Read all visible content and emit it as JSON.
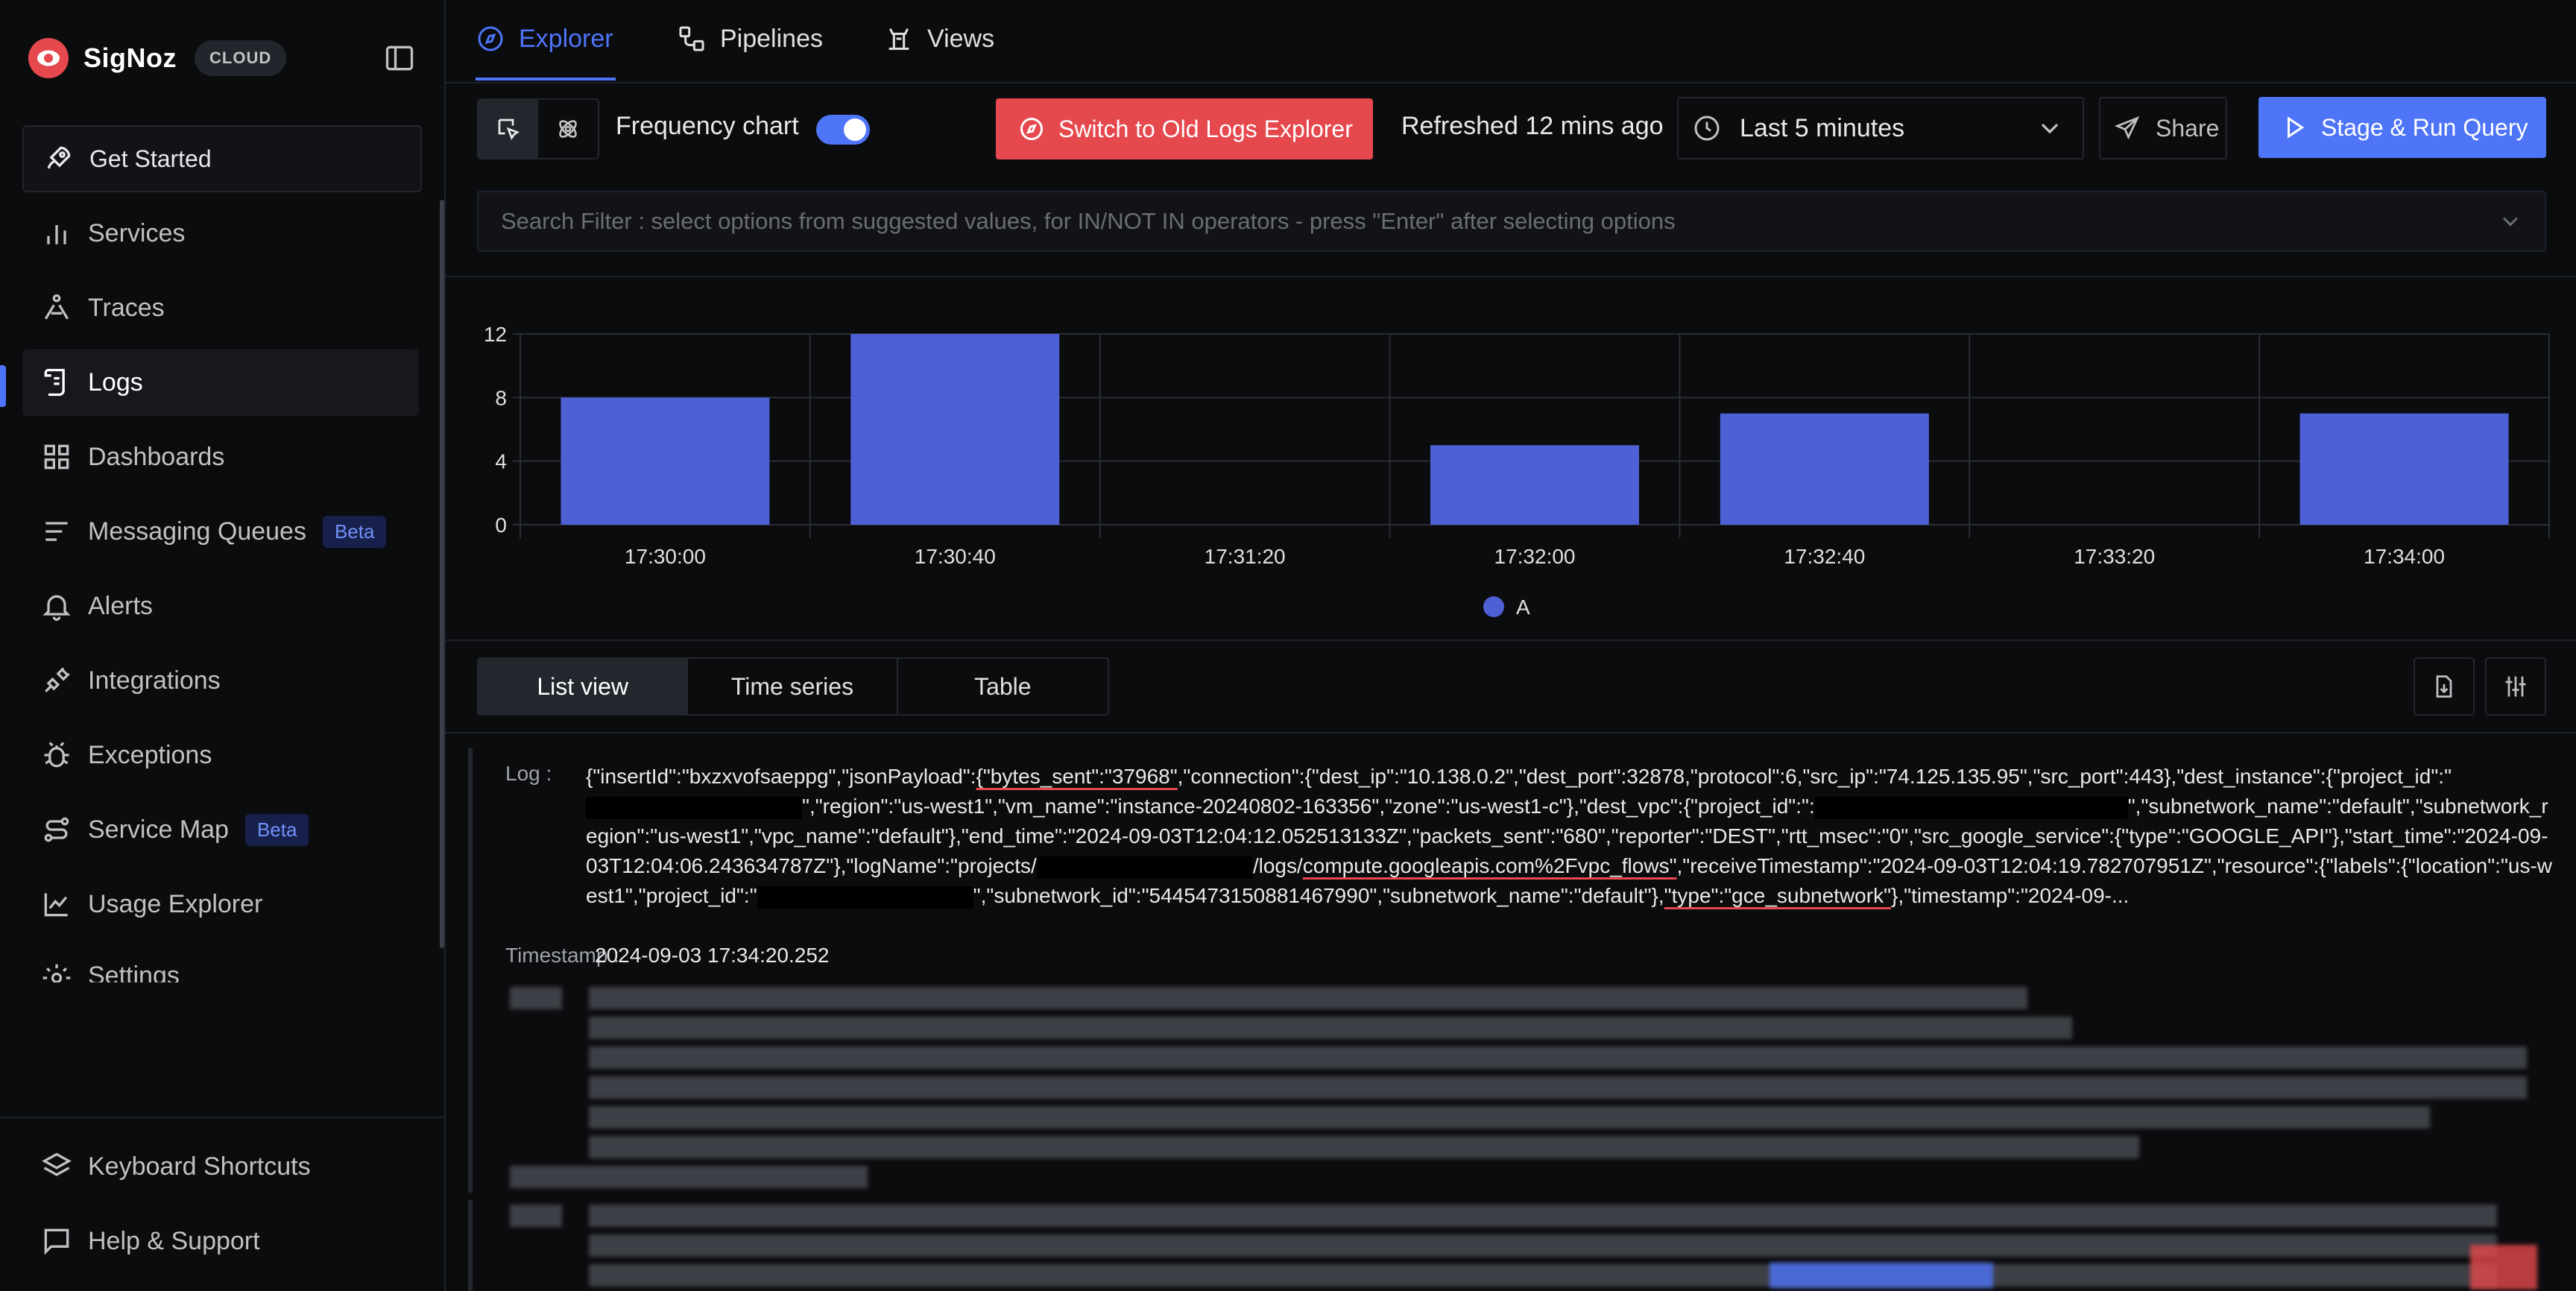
{
  "sidebar": {
    "brand": "SigNoz",
    "badge": "CLOUD",
    "get_started": "Get Started",
    "items": [
      {
        "label": "Services",
        "icon": "bar-chart-icon"
      },
      {
        "label": "Traces",
        "icon": "draw-path-icon"
      },
      {
        "label": "Logs",
        "icon": "scroll-text-icon",
        "active": true
      },
      {
        "label": "Dashboards",
        "icon": "grid-icon"
      },
      {
        "label": "Messaging Queues",
        "icon": "list-icon",
        "badge": "Beta"
      },
      {
        "label": "Alerts",
        "icon": "bell-icon"
      },
      {
        "label": "Integrations",
        "icon": "plug-icon"
      },
      {
        "label": "Exceptions",
        "icon": "bug-icon"
      },
      {
        "label": "Service Map",
        "icon": "route-icon",
        "badge": "Beta"
      },
      {
        "label": "Usage Explorer",
        "icon": "line-chart-icon"
      },
      {
        "label": "Settings",
        "icon": "gear-icon"
      }
    ],
    "bottom": [
      {
        "label": "Keyboard Shortcuts",
        "icon": "layers-icon"
      },
      {
        "label": "Help & Support",
        "icon": "message-square-icon"
      }
    ]
  },
  "tabs": [
    {
      "label": "Explorer",
      "icon": "compass-icon",
      "active": true
    },
    {
      "label": "Pipelines",
      "icon": "workflow-icon"
    },
    {
      "label": "Views",
      "icon": "tower-icon"
    }
  ],
  "toolbar": {
    "frequency_label": "Frequency chart",
    "frequency_on": true,
    "old_explorer": "Switch to Old Logs Explorer",
    "refreshed": "Refreshed 12 mins ago",
    "time_range": "Last 5 minutes",
    "share": "Share",
    "run": "Stage & Run Query"
  },
  "search": {
    "placeholder": "Search Filter : select options from suggested values, for IN/NOT IN operators - press \"Enter\" after selecting options"
  },
  "chart_data": {
    "type": "bar",
    "categories": [
      "17:30:00",
      "17:30:40",
      "17:31:20",
      "17:32:00",
      "17:32:40",
      "17:33:20",
      "17:34:00"
    ],
    "series": [
      {
        "name": "A",
        "color": "#4e60d6",
        "values": [
          8,
          12,
          0,
          5,
          7,
          0,
          7
        ]
      }
    ],
    "yticks": [
      0,
      4,
      8,
      12
    ],
    "ylim": [
      0,
      12
    ],
    "legend": "bottom-center",
    "grid": true
  },
  "view_tabs": [
    "List view",
    "Time series",
    "Table"
  ],
  "log": {
    "label": "Log :",
    "timestamp_label": "Timestamp :",
    "timestamp": "2024-09-03 17:34:20.252",
    "line1_a": "{\"insertId\":\"bxzxvofsaeppg\",\"jsonPayload\":",
    "line1_u": "{\"bytes_sent\":\"37968\"",
    "line1_b": ",\"connection\":{\"dest_ip\":\"10.138.0.2\",\"dest_port\":32878,\"protocol\":6,\"src_ip\":\"74.125.135.95\",\"src_port\":443},\"dest_instance\":",
    "line2_a": "{\"project_id\":\"",
    "line2_b": "\",\"region\":\"us-west1\",\"vm_name\":\"instance-20240802-163356\",\"zone\":\"us-west1-c\"},\"dest_vpc\":{\"project_id\":\":",
    "line3_b": "\",\"subnetwork_name\":\"default\",\"subnetwork_region\":\"us-west1\",\"vpc_name\":\"default\"},\"end_time\":\"2024-09-",
    "line4": "03T12:04:12.052513133Z\",\"packets_sent\":\"680\",\"reporter\":\"DEST\",\"rtt_msec\":\"0\",\"src_google_service\":{\"type\":\"GOOGLE_API\"},\"start_time\":\"2024-09-",
    "line5_a": "03T12:04:06.243634787Z\"},\"logName\":\"projects/",
    "line5_b": "/logs/",
    "line5_u": "compute.googleapis.com%2Fvpc_flows\"",
    "line5_c": ",\"receiveTimestamp\":\"2024-09-03T12:04:19.782707951Z\",\"resource\":{\"labels\":",
    "line6_a": "{\"location\":\"us-west1\",\"project_id\":\"",
    "line6_b": "\",\"subnetwork_id\":\"5445473150881467990\",\"subnetwork_name\":\"default\"},",
    "line6_u": "\"type\":\"gce_subnetwork\"",
    "line6_c": "},\"timestamp\":\"2024-09-..."
  }
}
